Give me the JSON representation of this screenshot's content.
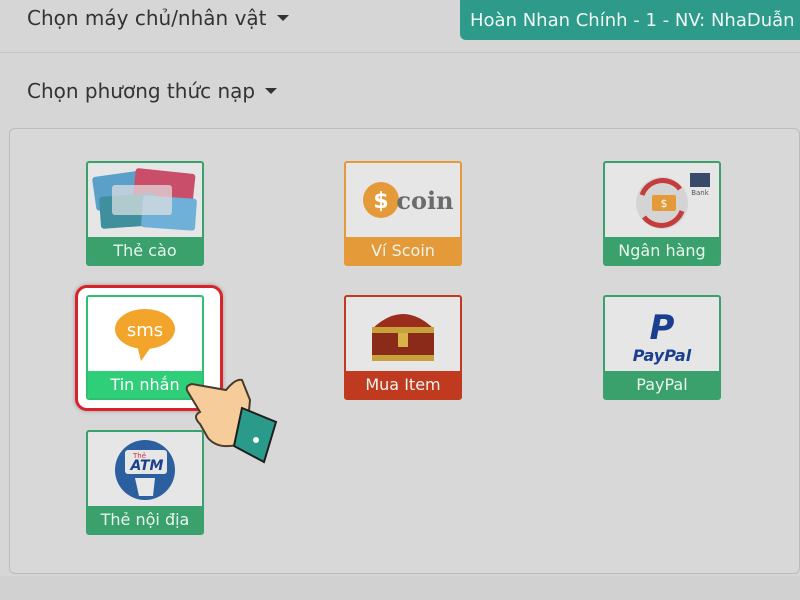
{
  "header": {
    "server_label": "Chọn máy chủ/nhân vật",
    "server_value": "Hoàn Nhan Chính - 1 - NV: NhaDuẫn",
    "method_label": "Chọn phương thức nạp"
  },
  "methods": [
    {
      "label": "Thẻ cào",
      "icon": "scratch-card-icon"
    },
    {
      "label": "Ví Scoin",
      "icon": "scoin-wallet-icon",
      "logo_text": "coin"
    },
    {
      "label": "Ngân hàng",
      "icon": "bank-icon",
      "badge": "Bank"
    },
    {
      "label": "Tin nhắn",
      "icon": "sms-icon",
      "logo_text": "sms"
    },
    {
      "label": "Mua Item",
      "icon": "treasure-chest-icon"
    },
    {
      "label": "PayPal",
      "icon": "paypal-icon",
      "logo_text": "PayPal"
    },
    {
      "label": "Thẻ nội địa",
      "icon": "atm-card-icon",
      "logo_text": "ATM",
      "logo_small": "Thẻ"
    }
  ],
  "colors": {
    "green": "#3aa06c",
    "orange": "#e59a3a",
    "red": "#c03a1f",
    "teal": "#2e9a89",
    "highlight": "#d8232a"
  }
}
